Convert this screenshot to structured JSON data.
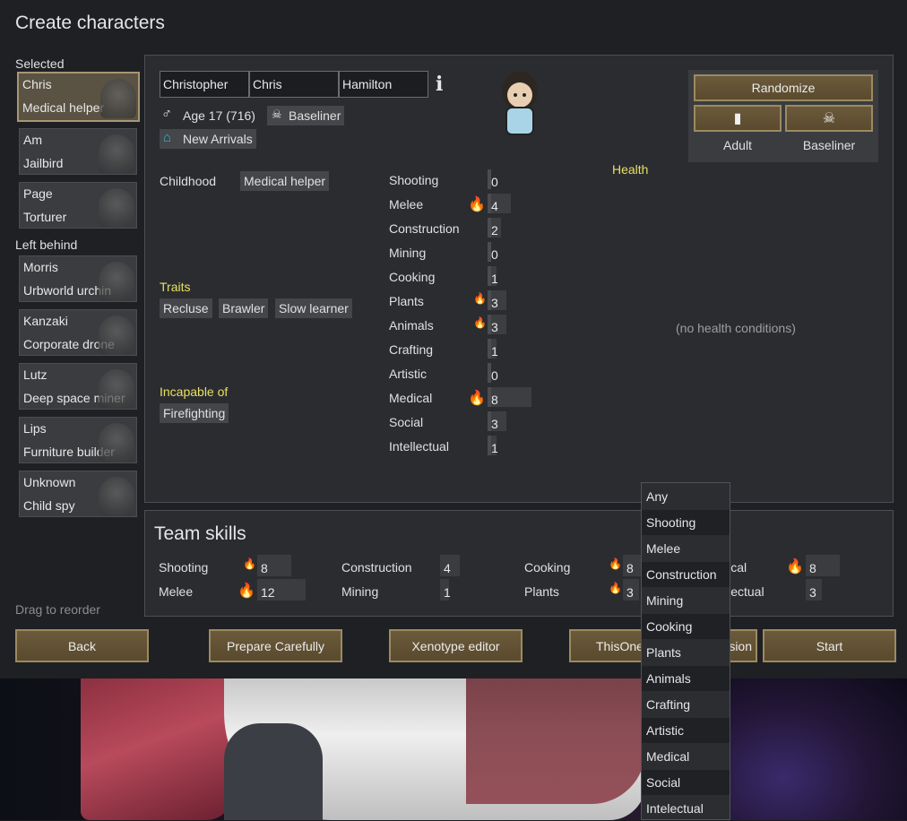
{
  "title": "Create characters",
  "sidebar": {
    "selected_label": "Selected",
    "left_behind_label": "Left behind",
    "drag_hint": "Drag to reorder",
    "selected": [
      {
        "name": "Chris",
        "backstory": "Medical helper"
      },
      {
        "name": "Am",
        "backstory": "Jailbird"
      },
      {
        "name": "Page",
        "backstory": "Torturer"
      }
    ],
    "left_behind": [
      {
        "name": "Morris",
        "backstory": "Urbworld urchin"
      },
      {
        "name": "Kanzaki",
        "backstory": "Corporate drone"
      },
      {
        "name": "Lutz",
        "backstory": "Deep space miner"
      },
      {
        "name": "Lips",
        "backstory": "Furniture builder"
      },
      {
        "name": "Unknown",
        "backstory": "Child spy"
      }
    ]
  },
  "pawn": {
    "first_name": "Christopher",
    "nick_name": "Chris",
    "last_name": "Hamilton",
    "age": "Age 17 (716)",
    "xenotype": "Baseliner",
    "faction": "New Arrivals",
    "childhood_label": "Childhood",
    "childhood": "Medical helper",
    "traits_label": "Traits",
    "traits": [
      "Recluse",
      "Brawler",
      "Slow learner"
    ],
    "incapable_label": "Incapable of",
    "incapable": [
      "Firefighting"
    ],
    "health_label": "Health",
    "health_status": "(no health conditions)"
  },
  "controls": {
    "randomize": "Randomize",
    "age_label": "Adult",
    "xeno_label": "Baseliner"
  },
  "skills": [
    {
      "name": "Shooting",
      "value": "0",
      "passion": 0,
      "level": 0
    },
    {
      "name": "Melee",
      "value": "4",
      "passion": 2,
      "level": 4
    },
    {
      "name": "Construction",
      "value": "2",
      "passion": 0,
      "level": 2
    },
    {
      "name": "Mining",
      "value": "0",
      "passion": 0,
      "level": 0
    },
    {
      "name": "Cooking",
      "value": "1",
      "passion": 0,
      "level": 1
    },
    {
      "name": "Plants",
      "value": "3",
      "passion": 1,
      "level": 3
    },
    {
      "name": "Animals",
      "value": "3",
      "passion": 1,
      "level": 3
    },
    {
      "name": "Crafting",
      "value": "1",
      "passion": 0,
      "level": 1
    },
    {
      "name": "Artistic",
      "value": "0",
      "passion": 0,
      "level": 0
    },
    {
      "name": "Medical",
      "value": "8",
      "passion": 2,
      "level": 8
    },
    {
      "name": "Social",
      "value": "3",
      "passion": 0,
      "level": 3
    },
    {
      "name": "Intellectual",
      "value": "1",
      "passion": 0,
      "level": 1
    }
  ],
  "team": {
    "title": "Team skills",
    "skills": [
      {
        "name": "Shooting",
        "value": "8",
        "passion": 1
      },
      {
        "name": "Melee",
        "value": "12",
        "passion": 2
      },
      {
        "name": "Construction",
        "value": "4",
        "passion": 0
      },
      {
        "name": "Mining",
        "value": "1",
        "passion": 0
      },
      {
        "name": "Cooking",
        "value": "8",
        "passion": 1
      },
      {
        "name": "Plants",
        "value": "3",
        "passion": 1
      },
      {
        "name": "lical",
        "value": "8",
        "passion": 2
      },
      {
        "name": "llectual",
        "value": "3",
        "passion": 0
      }
    ]
  },
  "buttons": {
    "back": "Back",
    "prepare": "Prepare Carefully",
    "xenotype": "Xenotype editor",
    "thisone_left": "ThisOne",
    "thisone_right": "sion",
    "start": "Start"
  },
  "dropdown": [
    "Any",
    "Shooting",
    "Melee",
    "Construction",
    "Mining",
    "Cooking",
    "Plants",
    "Animals",
    "Crafting",
    "Artistic",
    "Medical",
    "Social",
    "Intelectual"
  ],
  "colors": {
    "accent_gold": "#9c8a60",
    "passion": "#f0a020",
    "section_yellow": "#e8e060"
  }
}
